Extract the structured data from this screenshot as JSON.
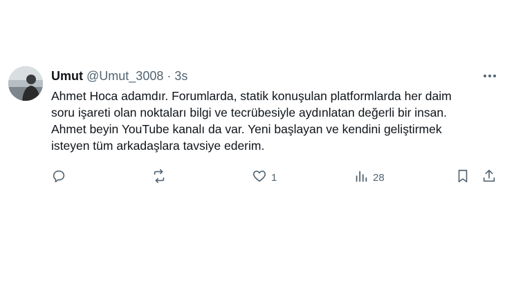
{
  "tweet": {
    "author": {
      "name": "Umut",
      "handle": "@Umut_3008"
    },
    "separator": "·",
    "time": "3s",
    "text_lines": [
      "Ahmet Hoca adamdır. Forumlarda, statik konuşulan platformlarda her daim",
      "soru işareti olan noktaları bilgi ve tecrübesiyle aydınlatan değerli bir insan.",
      "Ahmet beyin YouTube kanalı da var. Yeni başlayan ve kendini geliştirmek",
      "isteyen tüm arkadaşlara tavsiye ederim."
    ],
    "actions": {
      "reply_icon": "reply-icon",
      "retweet_icon": "retweet-icon",
      "like_icon": "heart-icon",
      "like_count": "1",
      "views_icon": "analytics-icon",
      "views_count": "28",
      "bookmark_icon": "bookmark-icon",
      "share_icon": "share-icon"
    },
    "more_icon": "more-horizontal-icon"
  },
  "colors": {
    "text": "#0f1419",
    "secondary": "#536471",
    "background": "#ffffff"
  }
}
